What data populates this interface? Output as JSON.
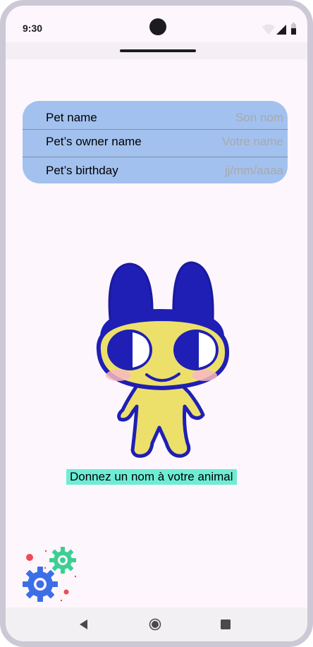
{
  "status_bar": {
    "time": "9:30"
  },
  "form": {
    "fields": [
      {
        "label": "Pet name",
        "placeholder": "Son nom"
      },
      {
        "label": "Pet’s owner name",
        "placeholder": "Votre name"
      },
      {
        "label": "Pet’s birthday",
        "placeholder": "jj/mm/aaaa"
      }
    ]
  },
  "caption": "Donnez un nom à votre animal",
  "colors": {
    "form_background": "#a3c1ee",
    "caption_highlight": "#6eecd5",
    "pet_body": "#ede06a",
    "pet_outline": "#1f1fb5"
  }
}
